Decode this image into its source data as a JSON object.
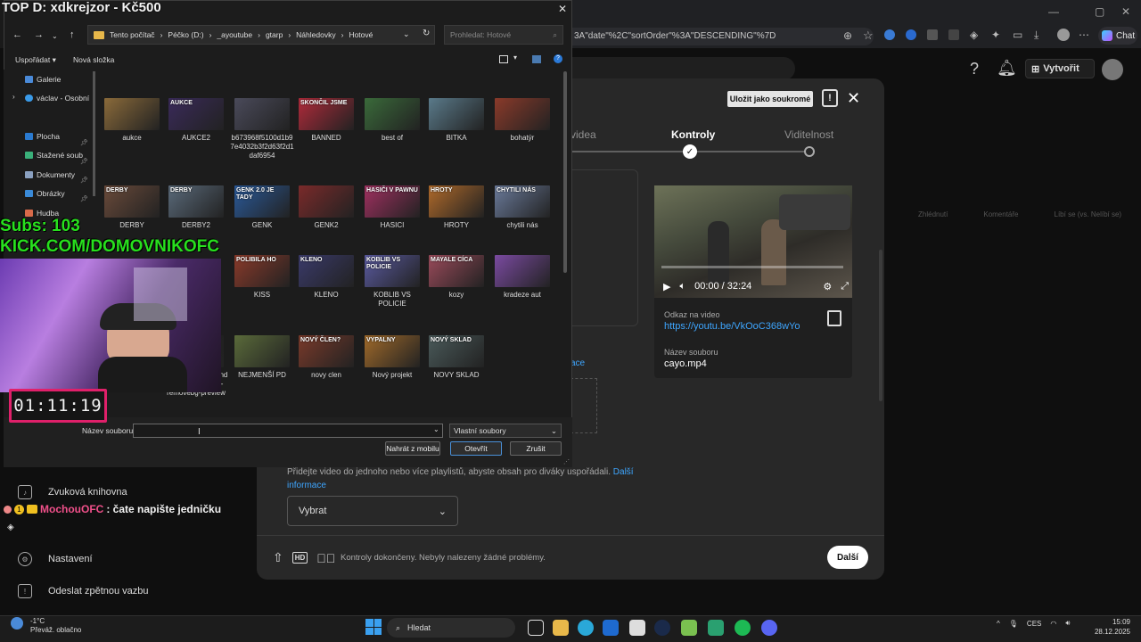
{
  "stream": {
    "title": "TOP D: xdkrejzor - Kč500",
    "subs": "Subs: 103",
    "kick": "KICK.COM/DOMOVNIKOFC",
    "timer": "01:11:19",
    "chat_user": "MochouOFC",
    "chat_message": ": čate napište jedničku"
  },
  "browser": {
    "url_fragment": "3A\"date\"%2C\"sortOrder\"%3A\"DESCENDING\"%7D",
    "chat_tab": "Chat"
  },
  "studio": {
    "create_label": "Vytvořit",
    "save_private_label": "Uložit jako soukromé",
    "steps": [
      "videa",
      "Kontroly",
      "Viditelnost"
    ],
    "active_step": 1,
    "stats_headers": [
      "Zhlédnutí",
      "Komentáře",
      "Líbí se (vs. Nelíbí se)"
    ],
    "video_time": "00:00 / 32:24",
    "video_progress": 0,
    "link_label": "Odkaz na video",
    "link_value": "https://youtu.be/VkOoC368wYo",
    "filename_label": "Název souboru",
    "filename_value": "cayo.mp4",
    "partial_link": "ace",
    "playlist_text": "Přidejte video do jednoho nebo více playlistů, abyste obsah pro diváky uspořádali.",
    "playlist_link": "Další informace",
    "select_label": "Vybrat",
    "checks_status": "Kontroly dokončeny. Nebyly nalezeny žádné problémy.",
    "next_label": "Další",
    "sidebar": [
      "Zvuková knihovna",
      "Nastavení",
      "Odeslat zpětnou vazbu"
    ]
  },
  "file_dialog": {
    "path": [
      "Tento počítač",
      "Péčko (D:)",
      "_ayoutube",
      "gtarp",
      "Náhledovky",
      "Hotové"
    ],
    "search_placeholder": "Prohledat: Hotové",
    "organize_label": "Uspořádat",
    "new_folder_label": "Nová složka",
    "nav_items": [
      "Galerie",
      "václav - Osobní",
      "Plocha",
      "Stažené soub",
      "Dokumenty",
      "Obrázky",
      "Hudba"
    ],
    "files": [
      [
        "aukce",
        "AUKCE2",
        "b673968f5100d1b97e4032b3f2d63f2d1daf6954",
        "BANNED",
        "best of",
        "BITKA",
        "bohatýr"
      ],
      [
        "DERBY",
        "DERBY2",
        "GENK",
        "GENK2",
        "HASICI",
        "HROTY",
        "chytili nás"
      ],
      [
        "",
        "",
        "KISS",
        "KLENO",
        "KOBLIB VS POLICIE",
        "kozy",
        "kradeze aut"
      ],
      [
        "",
        "manga_background_transparent_02-removebg-preview",
        "NEJMENŠÍ PD",
        "novy clen",
        "Nový projekt",
        "NOVY SKLAD",
        ""
      ]
    ],
    "thumb_colors": [
      [
        "#8a6a3a",
        "#3a2a5a",
        "#4a4a5a",
        "#b02a3a",
        "#3a6a3a",
        "#5a7a8a",
        "#8a3a2a"
      ],
      [
        "#6a4a3a",
        "#5a6a7a",
        "#2a5a9a",
        "#7a2a2a",
        "#a03060",
        "#b06a2a",
        "#6a7a9a"
      ],
      [
        "#3a3a3a",
        "#3a3a3a",
        "#8a3a2a",
        "#3a3a6a",
        "#5a5aa0",
        "#9a4a5a",
        "#7a4aa0"
      ],
      [
        "#3a3a3a",
        "#1e1e1e",
        "#5a6a3a",
        "#7a3a2a",
        "#a06a2a",
        "#4a5a5a",
        "#1c1c1c"
      ]
    ],
    "thumb_captions": [
      [
        "",
        "AUKCE",
        "",
        "SKONČIL JSME",
        "",
        "",
        ""
      ],
      [
        "DERBY",
        "DERBY",
        "GENK 2.0 JE TADY",
        "",
        "HASIČI V PAWNU",
        "HROTY",
        "CHYTILI NÁS"
      ],
      [
        "",
        "",
        "POLIBILA HO",
        "KLENO",
        "KOBLIB VS POLICIE",
        "MAYALE CÍCA",
        ""
      ],
      [
        "",
        "",
        "",
        "NOVÝ ČLEN?",
        "VYPALNY",
        "NOVÝ SKLAD",
        ""
      ]
    ],
    "filename_label": "Název souboru:",
    "filename_value": "",
    "filter_label": "Vlastní soubory",
    "mobile_button": "Nahrát z mobilu",
    "open_button": "Otevřít",
    "cancel_button": "Zrušit"
  },
  "taskbar": {
    "temp": "-1°C",
    "weather": "Převáž. oblačno",
    "search_label": "Hledat",
    "lang": "CES",
    "time": "15:09",
    "date": "28.12.2025"
  }
}
